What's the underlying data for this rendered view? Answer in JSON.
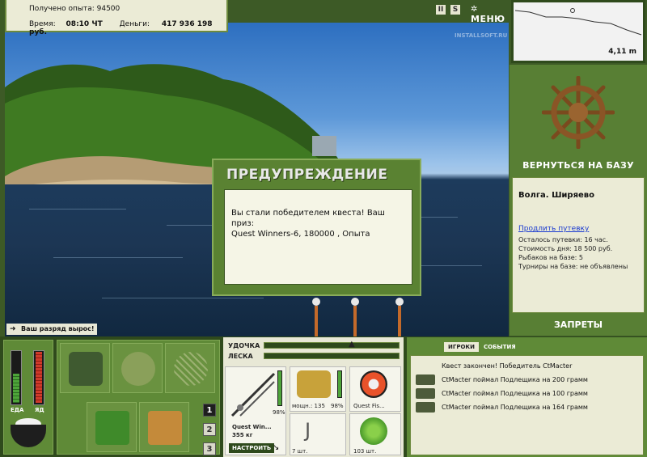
{
  "stats": {
    "xp_label": "Получено опыта:",
    "xp_value": "94500",
    "time_label": "Время:",
    "time_value": "08:10 ЧТ",
    "money_label": "Деньги:",
    "money_value": "417 936 198 руб."
  },
  "topbar": {
    "pause_icon": "II",
    "s_icon": "S",
    "menu_label": "МЕНЮ"
  },
  "watermark": "INSTALLSOFT.RU",
  "depth": {
    "value": "4,11 m"
  },
  "sidebar": {
    "back_label": "ВЕРНУТЬСЯ НА БАЗУ",
    "location": "Волга. Ширяево",
    "buy_pass": "Продлить путевку",
    "lines": [
      "Осталось путевки: 16 час.",
      "Стоимость дня: 18 500 руб.",
      "Рыбаков на базе: 5",
      "Турниры на базе: не объявлены"
    ],
    "bans_label": "ЗАПРЕТЫ"
  },
  "dialog": {
    "title": "ПРЕДУПРЕЖДЕНИЕ",
    "line1": "Вы стали победителем квеста! Ваш приз:",
    "line2": "Quest Winners-6, 180000 , Опыта"
  },
  "rank_notice": "Ваш разряд вырос!",
  "meters": {
    "food_label": "ЕДА",
    "poison_label": "ЯД",
    "food_level": 0.55,
    "poison_level": 0.95
  },
  "slots": [
    "1",
    "2",
    "3"
  ],
  "tackle": {
    "rod_label": "УДОЧКА",
    "line_label": "ЛЕСКА",
    "rod_name": "Quest Win...",
    "rod_weight": "355 кг",
    "rod_condition": "98%",
    "setup_button": "НАСТРОИТЬ",
    "reel_power": "мощн.: 135",
    "reel_condition": "98%",
    "line_name": "Quest Fis...",
    "hook_count": "7 шт.",
    "bait_count": "103 шт."
  },
  "events": {
    "tab_players": "ИГРОКИ",
    "tab_events": "СОБЫТИЯ",
    "items": [
      "Квест закончен! Победитель CtMacter",
      "CtMacter поймал Подлещика на 200 грамм",
      "CtMacter поймал Подлещика на 100 грамм",
      "CtMacter поймал Подлещика на 164 грамм"
    ]
  }
}
